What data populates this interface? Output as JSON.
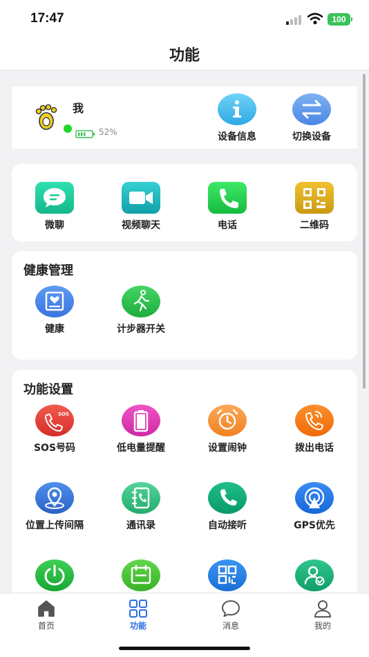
{
  "status_bar": {
    "time": "17:47",
    "battery": "100"
  },
  "nav": {
    "title": "功能"
  },
  "device": {
    "name": "我",
    "battery_percent": "52%",
    "info_label": "设备信息",
    "switch_label": "切换设备"
  },
  "comm": [
    {
      "label": "微聊",
      "icon": "chat-icon"
    },
    {
      "label": "视频聊天",
      "icon": "video-icon"
    },
    {
      "label": "电话",
      "icon": "phone-icon"
    },
    {
      "label": "二维码",
      "icon": "qrcode-icon"
    }
  ],
  "health": {
    "title": "健康管理",
    "items": [
      {
        "label": "健康",
        "icon": "health-icon"
      },
      {
        "label": "计步器开关",
        "icon": "pedometer-icon"
      }
    ]
  },
  "settings": {
    "title": "功能设置",
    "items": [
      {
        "label": "SOS号码",
        "icon": "sos-icon"
      },
      {
        "label": "低电量提醒",
        "icon": "low-battery-icon"
      },
      {
        "label": "设置闹钟",
        "icon": "alarm-icon"
      },
      {
        "label": "拨出电话",
        "icon": "outgoing-call-icon"
      },
      {
        "label": "位置上传间隔",
        "icon": "location-icon"
      },
      {
        "label": "通讯录",
        "icon": "contacts-icon"
      },
      {
        "label": "自动接听",
        "icon": "auto-answer-icon"
      },
      {
        "label": "GPS优先",
        "icon": "gps-icon"
      },
      {
        "label": "",
        "icon": "power-icon"
      },
      {
        "label": "",
        "icon": "calendar-icon"
      },
      {
        "label": "",
        "icon": "qr-scan-icon"
      },
      {
        "label": "",
        "icon": "user-check-icon"
      }
    ]
  },
  "tabs": [
    {
      "label": "首页",
      "icon": "home-icon"
    },
    {
      "label": "功能",
      "icon": "grid-icon"
    },
    {
      "label": "消息",
      "icon": "message-icon"
    },
    {
      "label": "我的",
      "icon": "profile-icon"
    }
  ],
  "colors": {
    "accent": "#2a6ce0",
    "online": "#1fd62b",
    "battery": "#3bc35b"
  }
}
